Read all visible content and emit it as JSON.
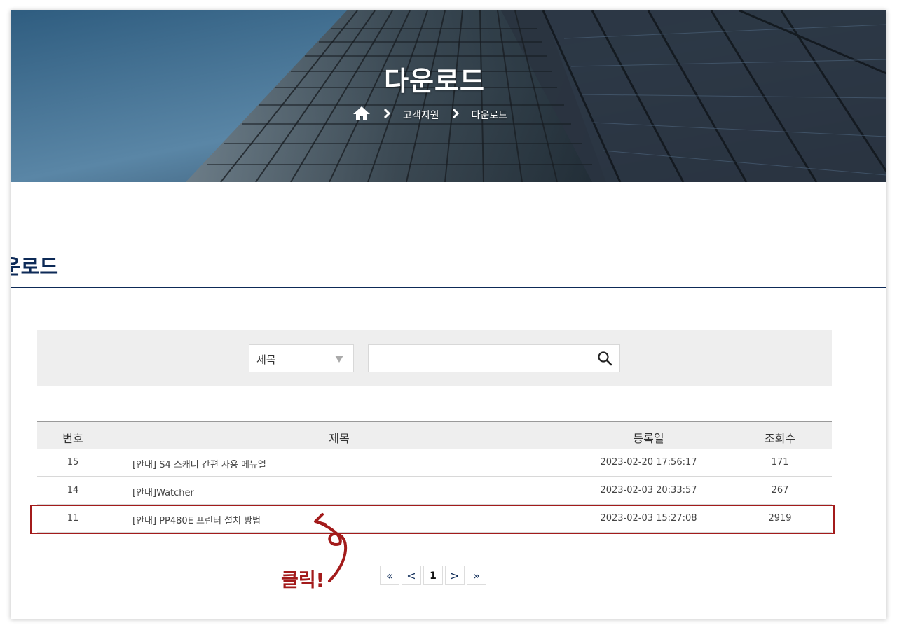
{
  "hero": {
    "title": "다운로드",
    "breadcrumb": {
      "home_icon": "home-icon",
      "level1": "고객지원",
      "level2": "다운로드"
    }
  },
  "page": {
    "title": "운로드"
  },
  "search": {
    "field_selected": "제목",
    "field_options_visible": [
      "제목"
    ],
    "query_value": "",
    "search_icon": "search-icon"
  },
  "table": {
    "headers": {
      "no": "번호",
      "title": "제목",
      "date": "등록일",
      "views": "조회수"
    },
    "rows": [
      {
        "no": "15",
        "title": "[안내] S4 스캐너 간편 사용 메뉴얼",
        "date": "2023-02-20 17:56:17",
        "views": "171"
      },
      {
        "no": "14",
        "title": "[안내]Watcher",
        "date": "2023-02-03 20:33:57",
        "views": "267"
      },
      {
        "no": "11",
        "title": "[안내] PP480E 프린터 설치 방법",
        "date": "2023-02-03 15:27:08",
        "views": "2919"
      }
    ]
  },
  "pagination": {
    "first": "«",
    "prev": "<",
    "current": "1",
    "next": ">",
    "last": "»"
  },
  "annotation": {
    "text": "클릭!",
    "color": "#a31b1b"
  },
  "colors": {
    "accent": "#0d2a57",
    "highlight": "#a31b1b"
  }
}
